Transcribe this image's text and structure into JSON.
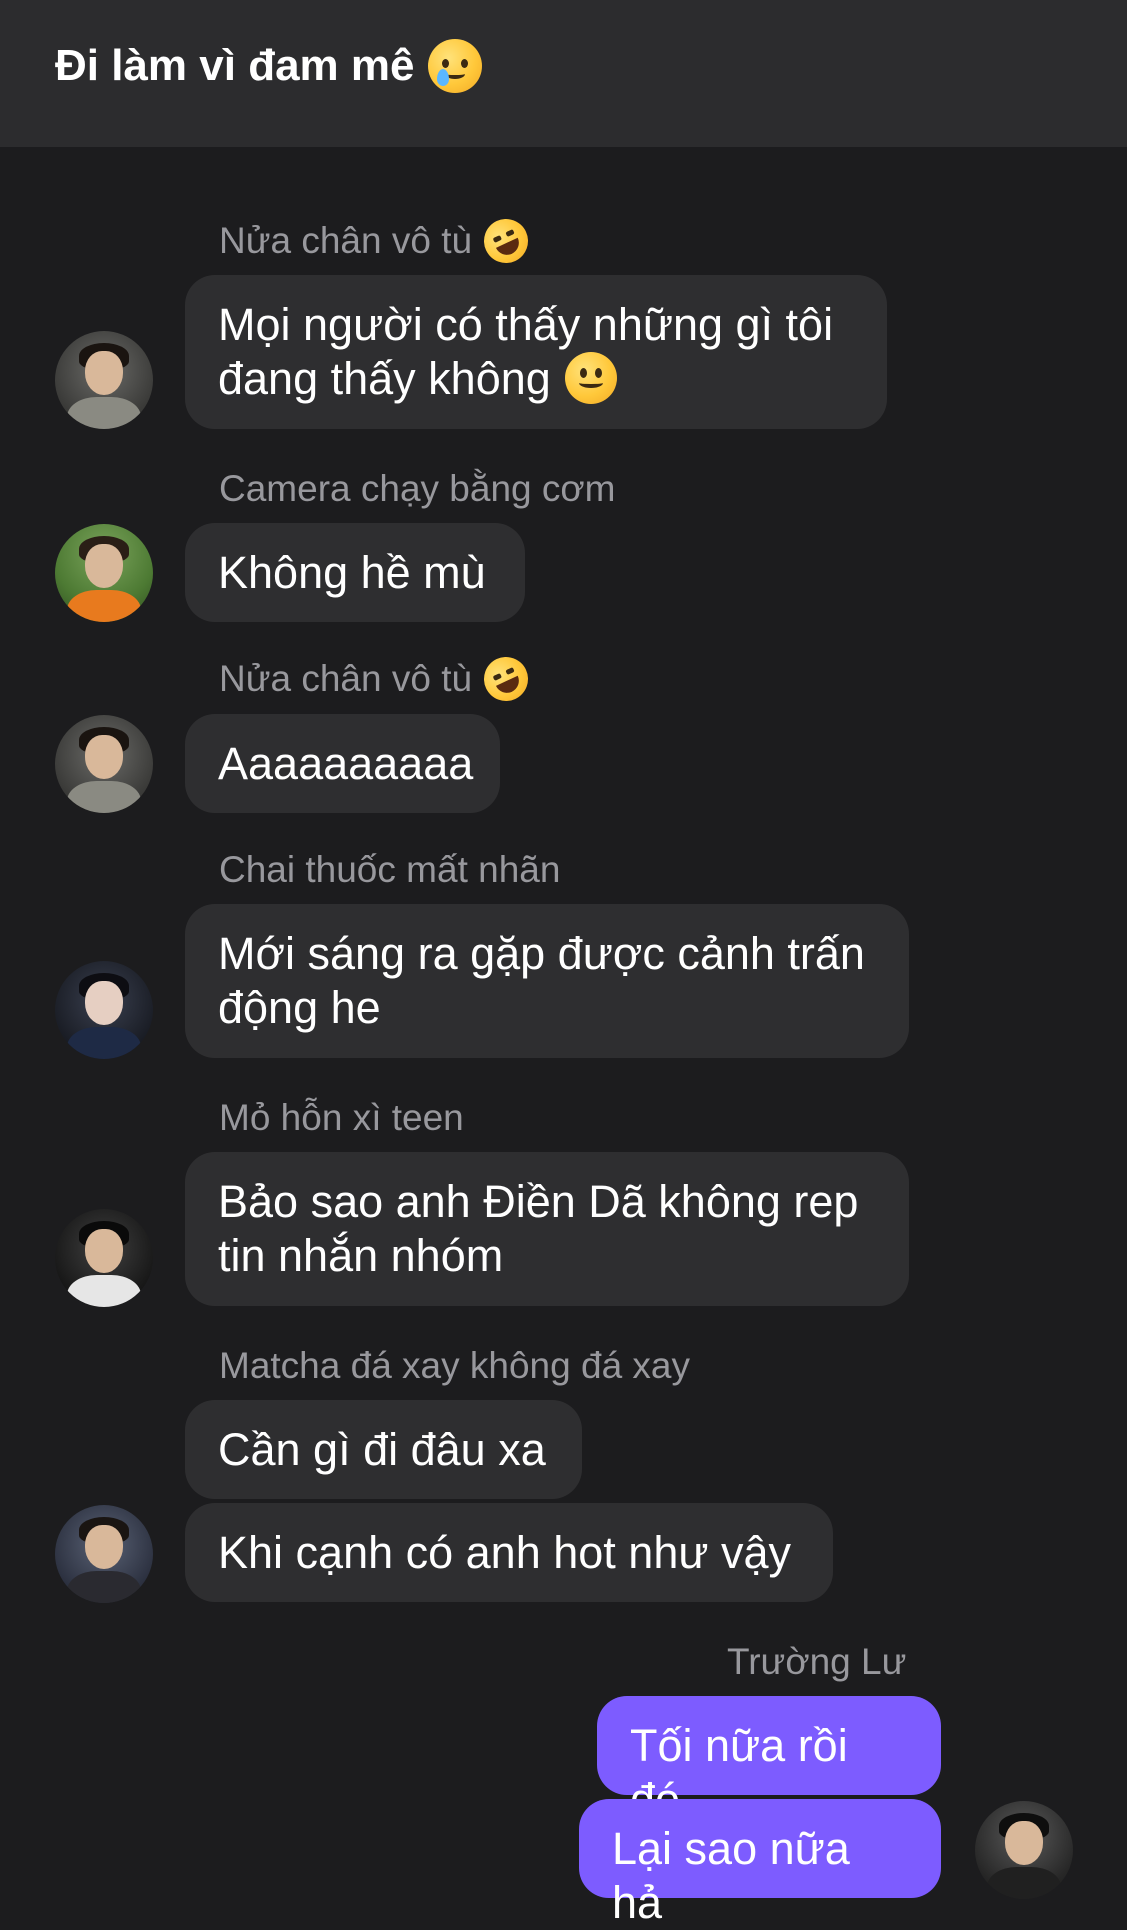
{
  "header": {
    "title": "Đi làm vì đam mê",
    "title_emoji": "face-holding-back-tears-emoji"
  },
  "messages": [
    {
      "sender": "Nửa chân vô tù",
      "sender_emoji": "rolling-on-floor-laughing-emoji",
      "text": "Mọi người có thấy những gì tôi\nđang thấy không",
      "text_emoji": "slightly-smiling-face-emoji"
    },
    {
      "sender": "Camera chạy bằng cơm",
      "text": "Không hề mù"
    },
    {
      "sender": "Nửa chân vô tù",
      "sender_emoji": "rolling-on-floor-laughing-emoji",
      "text": "Aaaaaaaaaa"
    },
    {
      "sender": "Chai thuốc mất nhãn",
      "text": "Mới sáng ra gặp được cảnh trấn\nđộng he"
    },
    {
      "sender": "Mỏ hỗn xì teen",
      "text": "Bảo sao anh Điền Dã không rep\ntin nhắn nhóm"
    },
    {
      "sender": "Matcha đá xay không đá xay",
      "texts": [
        "Cần gì đi đâu xa",
        "Khi cạnh có anh hot như vậy"
      ]
    },
    {
      "sender": "Trường Lư",
      "mine": true,
      "texts": [
        "Tối nữa rồi đó",
        "Lại sao nữa hả"
      ]
    }
  ],
  "colors": {
    "background": "#1c1c1e",
    "header": "#2c2c2e",
    "bubble_other": "#2e2e30",
    "bubble_mine": "#7d5cff",
    "sender_text": "#98989d"
  }
}
